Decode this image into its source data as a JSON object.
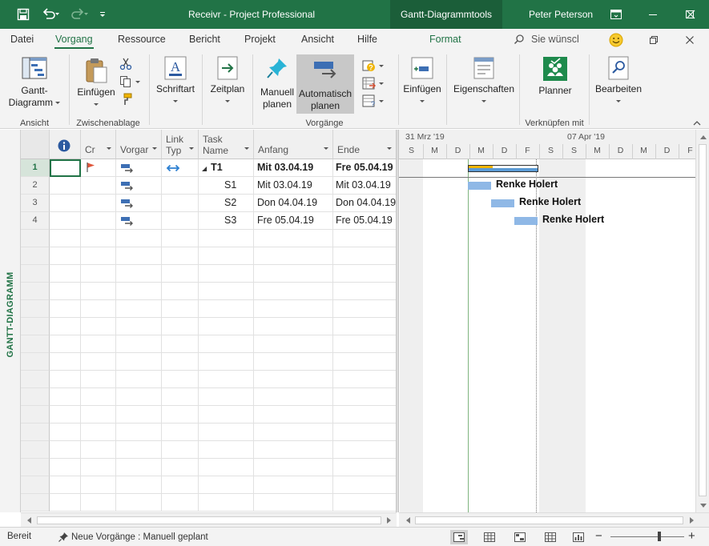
{
  "titlebar": {
    "title": "Receivr  -  Project Professional",
    "context_tab": "Gantt-Diagrammtools",
    "user": "Peter Peterson",
    "bg_color": "#217346"
  },
  "tabs": {
    "items": [
      "Datei",
      "Vorgang",
      "Ressource",
      "Bericht",
      "Projekt",
      "Ansicht",
      "Hilfe"
    ],
    "active": "Vorgang",
    "context": "Format",
    "search_placeholder": "Sie wünscl"
  },
  "ribbon": {
    "ansicht": {
      "button_line1": "Gantt-",
      "button_line2": "Diagramm",
      "group": "Ansicht"
    },
    "zwischenablage": {
      "paste": "Einfügen",
      "group": "Zwischenablage"
    },
    "schriftart": {
      "button": "Schriftart"
    },
    "zeitplan": {
      "button": "Zeitplan"
    },
    "vorgaenge": {
      "manual_line1": "Manuell",
      "manual_line2": "planen",
      "auto_line1": "Automatisch",
      "auto_line2": "planen",
      "group": "Vorgänge"
    },
    "einfuegen": {
      "button": "Einfügen"
    },
    "eigenschaften": {
      "button": "Eigenschaften"
    },
    "verknuepfen": {
      "button": "Planner",
      "group": "Verknüpfen mit"
    },
    "bearbeiten": {
      "button": "Bearbeiten"
    }
  },
  "view_label": "GANTT-DIAGRAMM",
  "table": {
    "headers": {
      "cr": "Cr",
      "vorgang": "Vorgar",
      "link_line1": "Link",
      "link_line2": "Typ",
      "task_line1": "Task",
      "task_line2": "Name",
      "anfang": "Anfang",
      "ende": "Ende"
    },
    "rows": [
      {
        "id": "1",
        "name": "T1",
        "start": "Mit 03.04.19",
        "end": "Fre 05.04.19",
        "summary": true
      },
      {
        "id": "2",
        "name": "S1",
        "start": "Mit 03.04.19",
        "end": "Mit 03.04.19",
        "summary": false
      },
      {
        "id": "3",
        "name": "S2",
        "start": "Don 04.04.19",
        "end": "Don 04.04.19",
        "summary": false
      },
      {
        "id": "4",
        "name": "S3",
        "start": "Fre 05.04.19",
        "end": "Fre 05.04.19",
        "summary": false
      }
    ]
  },
  "gantt": {
    "week1": "31 Mrz '19",
    "week2": "07 Apr '19",
    "days": [
      "S",
      "M",
      "D",
      "M",
      "D",
      "F",
      "S",
      "S",
      "M",
      "D",
      "M",
      "D",
      "F"
    ],
    "bar_labels": [
      "Renke Holert",
      "Renke Holert",
      "Renke Holert"
    ],
    "bar_color": "#8fb8e6",
    "summary_color": "#5b9bd5",
    "progress_color": "#f0b400"
  },
  "status": {
    "ready": "Bereit",
    "new_tasks": "Neue Vorgänge : Manuell geplant"
  }
}
